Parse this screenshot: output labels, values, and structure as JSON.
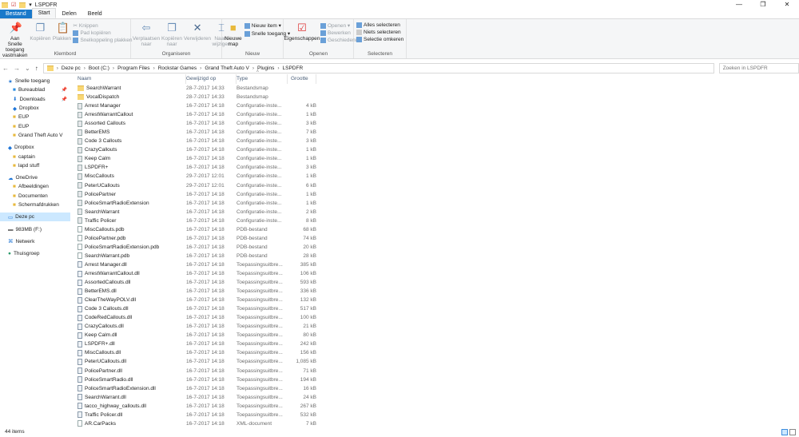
{
  "window": {
    "title": "LSPDFR",
    "minimize": "—",
    "maximize": "❐",
    "close": "✕"
  },
  "tabs": [
    {
      "label": "Bestand"
    },
    {
      "label": "Start"
    },
    {
      "label": "Delen"
    },
    {
      "label": "Beeld"
    }
  ],
  "ribbon": {
    "klembord": {
      "label": "Klembord",
      "pin": "Aan Snelle toegang vastmaken",
      "copy": "Kopiëren",
      "paste": "Plakken",
      "cut": "Knippen",
      "copy_path": "Pad kopiëren",
      "paste_shortcut": "Snelkoppeling plakken"
    },
    "organiseren": {
      "label": "Organiseren",
      "move": "Verplaatsen naar",
      "copy_to": "Kopiëren naar",
      "delete": "Verwijderen",
      "rename": "Naam wijzigen"
    },
    "nieuw": {
      "label": "Nieuw",
      "new_folder": "Nieuwe map",
      "new_item": "Nieuw item ▾",
      "easy_access": "Snelle toegang ▾"
    },
    "openen": {
      "label": "Openen",
      "properties": "Eigenschappen",
      "open": "Openen ▾",
      "edit": "Bewerken",
      "history": "Geschiedenis"
    },
    "selecteren": {
      "label": "Selecteren",
      "select_all": "Alles selecteren",
      "select_none": "Niets selecteren",
      "invert": "Selectie omkeren"
    }
  },
  "address": {
    "crumbs": [
      "Deze pc",
      "Boot (C:)",
      "Program Files",
      "Rockstar Games",
      "Grand Theft Auto V",
      "Plugins",
      "LSPDFR"
    ],
    "search_placeholder": "Zoeken in LSPDFR"
  },
  "sidebar": [
    {
      "label": "Snelle toegang",
      "type": "star",
      "level": 0
    },
    {
      "label": "Bureaublad",
      "type": "desk",
      "level": 1,
      "pinned": true
    },
    {
      "label": "Downloads",
      "type": "down",
      "level": 1,
      "pinned": true
    },
    {
      "label": "Dropbox",
      "type": "dropbox",
      "level": 1
    },
    {
      "label": "EUP",
      "type": "folder",
      "level": 1
    },
    {
      "label": "EUP",
      "type": "folder",
      "level": 1
    },
    {
      "label": "Grand Theft Auto V",
      "type": "folder",
      "level": 1
    },
    {
      "label": "",
      "type": "gap"
    },
    {
      "label": "Dropbox",
      "type": "dropbox",
      "level": 0
    },
    {
      "label": "captain",
      "type": "folder",
      "level": 1
    },
    {
      "label": "lapd stuff",
      "type": "folder",
      "level": 1
    },
    {
      "label": "",
      "type": "gap"
    },
    {
      "label": "OneDrive",
      "type": "cloud",
      "level": 0
    },
    {
      "label": "Afbeeldingen",
      "type": "folder",
      "level": 1
    },
    {
      "label": "Documenten",
      "type": "folder",
      "level": 1
    },
    {
      "label": "Schermafdrukken",
      "type": "folder",
      "level": 1
    },
    {
      "label": "",
      "type": "gap"
    },
    {
      "label": "Deze pc",
      "type": "pc",
      "level": 0,
      "selected": true
    },
    {
      "label": "",
      "type": "gap"
    },
    {
      "label": "983MB (F:)",
      "type": "drive",
      "level": 0
    },
    {
      "label": "",
      "type": "gap"
    },
    {
      "label": "Netwerk",
      "type": "net",
      "level": 0
    },
    {
      "label": "",
      "type": "gap"
    },
    {
      "label": "Thuisgroep",
      "type": "home",
      "level": 0
    }
  ],
  "columns": {
    "name": "Naam",
    "modified": "Gewijzigd op",
    "type": "Type",
    "size": "Grootte",
    "sort_arrow": "^"
  },
  "files": [
    {
      "name": "SearchWarrant",
      "date": "28-7-2017 14:33",
      "type": "Bestandsmap",
      "size": "",
      "kind": "folder"
    },
    {
      "name": "VocalDispatch",
      "date": "28-7-2017 14:33",
      "type": "Bestandsmap",
      "size": "",
      "kind": "folder"
    },
    {
      "name": "Arrest Manager",
      "date": "16-7-2017 14:18",
      "type": "Configuratie-inste...",
      "size": "4 kB",
      "kind": "cfg"
    },
    {
      "name": "ArrestWarrantCallout",
      "date": "16-7-2017 14:18",
      "type": "Configuratie-inste...",
      "size": "1 kB",
      "kind": "cfg"
    },
    {
      "name": "Assorted Callouts",
      "date": "16-7-2017 14:18",
      "type": "Configuratie-inste...",
      "size": "3 kB",
      "kind": "cfg"
    },
    {
      "name": "BetterEMS",
      "date": "16-7-2017 14:18",
      "type": "Configuratie-inste...",
      "size": "7 kB",
      "kind": "cfg"
    },
    {
      "name": "Code 3 Callouts",
      "date": "16-7-2017 14:18",
      "type": "Configuratie-inste...",
      "size": "3 kB",
      "kind": "cfg"
    },
    {
      "name": "CrazyCallouts",
      "date": "16-7-2017 14:18",
      "type": "Configuratie-inste...",
      "size": "1 kB",
      "kind": "cfg"
    },
    {
      "name": "Keep Calm",
      "date": "16-7-2017 14:18",
      "type": "Configuratie-inste...",
      "size": "1 kB",
      "kind": "cfg"
    },
    {
      "name": "LSPDFR+",
      "date": "16-7-2017 14:18",
      "type": "Configuratie-inste...",
      "size": "3 kB",
      "kind": "cfg"
    },
    {
      "name": "MiscCallouts",
      "date": "29-7-2017 12:01",
      "type": "Configuratie-inste...",
      "size": "1 kB",
      "kind": "cfg"
    },
    {
      "name": "PeterUCallouts",
      "date": "29-7-2017 12:01",
      "type": "Configuratie-inste...",
      "size": "6 kB",
      "kind": "cfg"
    },
    {
      "name": "PolicePartner",
      "date": "16-7-2017 14:18",
      "type": "Configuratie-inste...",
      "size": "1 kB",
      "kind": "cfg"
    },
    {
      "name": "PoliceSmartRadioExtension",
      "date": "16-7-2017 14:18",
      "type": "Configuratie-inste...",
      "size": "1 kB",
      "kind": "cfg"
    },
    {
      "name": "SearchWarrant",
      "date": "16-7-2017 14:18",
      "type": "Configuratie-inste...",
      "size": "2 kB",
      "kind": "cfg"
    },
    {
      "name": "Traffic Policer",
      "date": "16-7-2017 14:18",
      "type": "Configuratie-inste...",
      "size": "8 kB",
      "kind": "cfg"
    },
    {
      "name": "MiscCallouts.pdb",
      "date": "16-7-2017 14:18",
      "type": "PDB-bestand",
      "size": "68 kB",
      "kind": "file"
    },
    {
      "name": "PolicePartner.pdb",
      "date": "16-7-2017 14:18",
      "type": "PDB-bestand",
      "size": "74 kB",
      "kind": "file"
    },
    {
      "name": "PoliceSmartRadioExtension.pdb",
      "date": "16-7-2017 14:18",
      "type": "PDB-bestand",
      "size": "20 kB",
      "kind": "file"
    },
    {
      "name": "SearchWarrant.pdb",
      "date": "16-7-2017 14:18",
      "type": "PDB-bestand",
      "size": "28 kB",
      "kind": "file"
    },
    {
      "name": "Arrest Manager.dll",
      "date": "16-7-2017 14:18",
      "type": "Toepassingsuitbre...",
      "size": "385 kB",
      "kind": "dll"
    },
    {
      "name": "ArrestWarrantCallout.dll",
      "date": "16-7-2017 14:18",
      "type": "Toepassingsuitbre...",
      "size": "106 kB",
      "kind": "dll"
    },
    {
      "name": "AssortedCallouts.dll",
      "date": "16-7-2017 14:18",
      "type": "Toepassingsuitbre...",
      "size": "593 kB",
      "kind": "dll"
    },
    {
      "name": "BetterEMS.dll",
      "date": "16-7-2017 14:18",
      "type": "Toepassingsuitbre...",
      "size": "336 kB",
      "kind": "dll"
    },
    {
      "name": "ClearTheWayPOLV.dll",
      "date": "16-7-2017 14:18",
      "type": "Toepassingsuitbre...",
      "size": "132 kB",
      "kind": "dll"
    },
    {
      "name": "Code 3 Callouts.dll",
      "date": "16-7-2017 14:18",
      "type": "Toepassingsuitbre...",
      "size": "517 kB",
      "kind": "dll"
    },
    {
      "name": "CodeRedCallouts.dll",
      "date": "16-7-2017 14:18",
      "type": "Toepassingsuitbre...",
      "size": "100 kB",
      "kind": "dll"
    },
    {
      "name": "CrazyCallouts.dll",
      "date": "16-7-2017 14:18",
      "type": "Toepassingsuitbre...",
      "size": "21 kB",
      "kind": "dll"
    },
    {
      "name": "Keep Calm.dll",
      "date": "16-7-2017 14:18",
      "type": "Toepassingsuitbre...",
      "size": "80 kB",
      "kind": "dll"
    },
    {
      "name": "LSPDFR+.dll",
      "date": "16-7-2017 14:18",
      "type": "Toepassingsuitbre...",
      "size": "242 kB",
      "kind": "dll"
    },
    {
      "name": "MiscCallouts.dll",
      "date": "16-7-2017 14:18",
      "type": "Toepassingsuitbre...",
      "size": "156 kB",
      "kind": "dll"
    },
    {
      "name": "PeterUCallouts.dll",
      "date": "16-7-2017 14:18",
      "type": "Toepassingsuitbre...",
      "size": "1,085 kB",
      "kind": "dll"
    },
    {
      "name": "PolicePartner.dll",
      "date": "16-7-2017 14:18",
      "type": "Toepassingsuitbre...",
      "size": "71 kB",
      "kind": "dll"
    },
    {
      "name": "PoliceSmartRadio.dll",
      "date": "16-7-2017 14:18",
      "type": "Toepassingsuitbre...",
      "size": "194 kB",
      "kind": "dll"
    },
    {
      "name": "PoliceSmartRadioExtension.dll",
      "date": "16-7-2017 14:18",
      "type": "Toepassingsuitbre...",
      "size": "16 kB",
      "kind": "dll"
    },
    {
      "name": "SearchWarrant.dll",
      "date": "16-7-2017 14:18",
      "type": "Toepassingsuitbre...",
      "size": "24 kB",
      "kind": "dll"
    },
    {
      "name": "tacco_highway_callouts.dll",
      "date": "16-7-2017 14:18",
      "type": "Toepassingsuitbre...",
      "size": "267 kB",
      "kind": "dll"
    },
    {
      "name": "Traffic Policer.dll",
      "date": "16-7-2017 14:18",
      "type": "Toepassingsuitbre...",
      "size": "532 kB",
      "kind": "dll"
    },
    {
      "name": "AR.CarPacks",
      "date": "16-7-2017 14:18",
      "type": "XML-document",
      "size": "7 kB",
      "kind": "file"
    }
  ],
  "status": {
    "count": "44 items"
  }
}
